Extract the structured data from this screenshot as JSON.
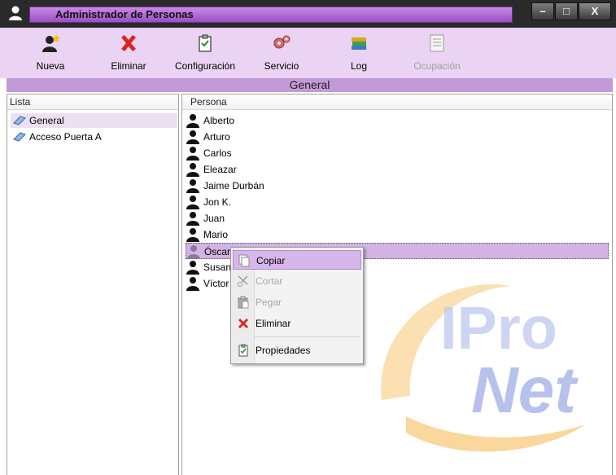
{
  "window": {
    "title": "Administrador de Personas",
    "controls": {
      "minimize": "–",
      "maximize": "□",
      "close": "X"
    }
  },
  "toolbar": {
    "items": [
      {
        "label": "Nueva",
        "icon": "new-person-icon"
      },
      {
        "label": "Eliminar",
        "icon": "delete-x-icon"
      },
      {
        "label": "Configuración",
        "icon": "configuration-icon"
      },
      {
        "label": "Servicio",
        "icon": "service-gear-icon"
      },
      {
        "label": "Log",
        "icon": "log-books-icon"
      },
      {
        "label": "Ocupación",
        "icon": "occupancy-icon",
        "disabled": true
      }
    ]
  },
  "section_title": "General",
  "lista": {
    "header": "Lista",
    "items": [
      {
        "label": "General",
        "selected": true
      },
      {
        "label": "Acceso Puerta A",
        "selected": false
      }
    ]
  },
  "persona": {
    "header": "Persona",
    "people": [
      "Alberto",
      "Arturo",
      "Carlos",
      "Eleazar",
      "Jaime Durbán",
      "Jon K.",
      "Juan",
      "Mario",
      "Óscar N.",
      "Susan",
      "Víctor"
    ],
    "selected": "Óscar N."
  },
  "context_menu": {
    "items": [
      {
        "label": "Copiar",
        "icon": "copy-icon",
        "state": "hover"
      },
      {
        "label": "Cortar",
        "icon": "cut-icon",
        "state": "disabled"
      },
      {
        "label": "Pegar",
        "icon": "paste-icon",
        "state": "disabled"
      },
      {
        "label": "Eliminar",
        "icon": "delete-icon",
        "state": "normal"
      },
      {
        "label": "Propiedades",
        "icon": "properties-icon",
        "state": "normal"
      }
    ]
  },
  "colors": {
    "accent": "#c39ad8",
    "toolbar_bg": "#ebd3f3",
    "selection": "#d2b3e4",
    "watermark_orange": "#f5a623",
    "watermark_blue": "#7b8fd6"
  }
}
